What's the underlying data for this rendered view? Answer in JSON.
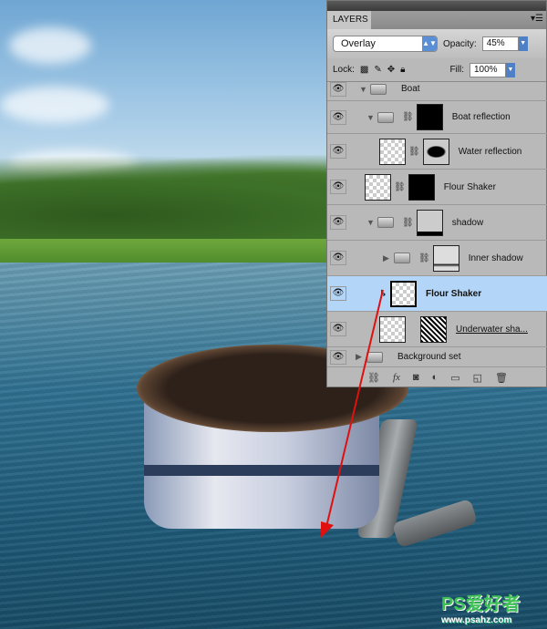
{
  "panel": {
    "tab": "LAYERS",
    "menu_icon": "panel-menu-icon",
    "blend_mode": "Overlay",
    "opacity_label": "Opacity:",
    "opacity": "45%",
    "lock_label": "Lock:",
    "fill_label": "Fill:",
    "fill": "100%"
  },
  "layers": [
    {
      "name": "Boat",
      "type": "group",
      "expanded": true
    },
    {
      "name": "Boat reflection",
      "type": "group",
      "expanded": true
    },
    {
      "name": "Water reflection",
      "type": "layer"
    },
    {
      "name": "Flour Shaker",
      "type": "smart-object"
    },
    {
      "name": "shadow",
      "type": "group",
      "expanded": true
    },
    {
      "name": "Inner shadow",
      "type": "group",
      "expanded": false
    },
    {
      "name": "Flour Shaker",
      "type": "smart-object",
      "selected": true
    },
    {
      "name": "Underwater sha...",
      "type": "layer"
    },
    {
      "name": "Background set",
      "type": "group",
      "expanded": false
    }
  ],
  "selection_color": "#b3d5f7",
  "watermark": {
    "logo": "PS爱好者",
    "url": "www.psahz.com"
  }
}
